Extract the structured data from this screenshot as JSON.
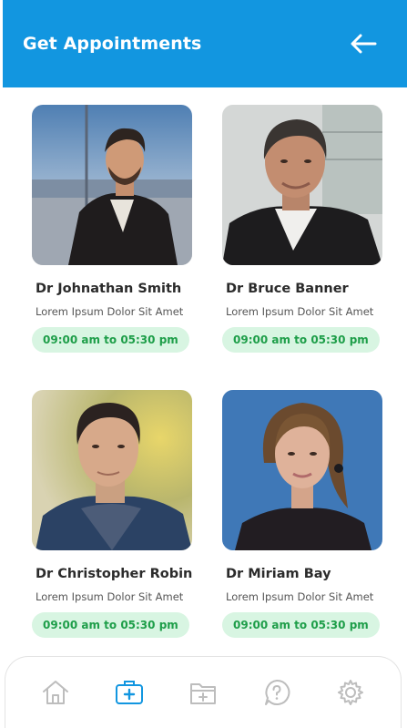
{
  "header": {
    "title": "Get Appointments",
    "back_icon": "arrow-left-icon",
    "background": "#1296e0"
  },
  "doctors": [
    {
      "name": "Dr Johnathan Smith",
      "description": "Lorem Ipsum Dolor Sit Amet",
      "hours": "09:00 am to 05:30 pm"
    },
    {
      "name": "Dr Bruce Banner",
      "description": "Lorem Ipsum Dolor Sit Amet",
      "hours": "09:00 am to 05:30 pm"
    },
    {
      "name": "Dr Christopher Robin",
      "description": "Lorem Ipsum Dolor Sit Amet",
      "hours": "09:00 am to 05:30 pm"
    },
    {
      "name": "Dr Miriam Bay",
      "description": "Lorem Ipsum Dolor Sit Amet",
      "hours": "09:00 am to 05:30 pm"
    }
  ],
  "colors": {
    "accent": "#1296e0",
    "pill_bg": "#d8f5e2",
    "pill_text": "#1e9e49"
  },
  "bottom_nav": {
    "items": [
      {
        "icon": "home-icon",
        "active": false
      },
      {
        "icon": "medical-kit-icon",
        "active": true
      },
      {
        "icon": "folder-add-icon",
        "active": false
      },
      {
        "icon": "help-icon",
        "active": false
      },
      {
        "icon": "settings-gear-icon",
        "active": false
      }
    ]
  }
}
